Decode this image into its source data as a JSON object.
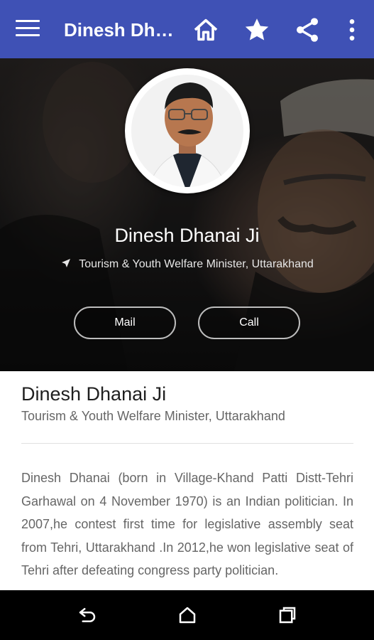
{
  "appbar": {
    "title": "Dinesh Dhanai Ji",
    "background": "#3f51b5",
    "icons": [
      "menu-icon",
      "home-icon",
      "star-icon",
      "share-icon",
      "more-vert-icon"
    ]
  },
  "profile": {
    "name": "Dinesh Dhanai Ji",
    "role": "Tourism & Youth Welfare Minister, Uttarakhand",
    "location_icon": "navigation-arrow-icon",
    "mail_label": "Mail",
    "call_label": "Call"
  },
  "details": {
    "name": "Dinesh Dhanai Ji",
    "role": "Tourism & Youth Welfare Minister, Uttarakhand",
    "bio": "Dinesh Dhanai (born in Village-Khand Patti Distt-Tehri Garhawal on 4 November 1970) is an Indian politician. In 2007,he contest first time for legislative assembly seat from Tehri, Uttarakhand .In 2012,he won legislative seat of Tehri after defeating congress party politician."
  },
  "system_nav": {
    "icons": [
      "back-icon",
      "home-nav-icon",
      "recents-icon"
    ]
  }
}
